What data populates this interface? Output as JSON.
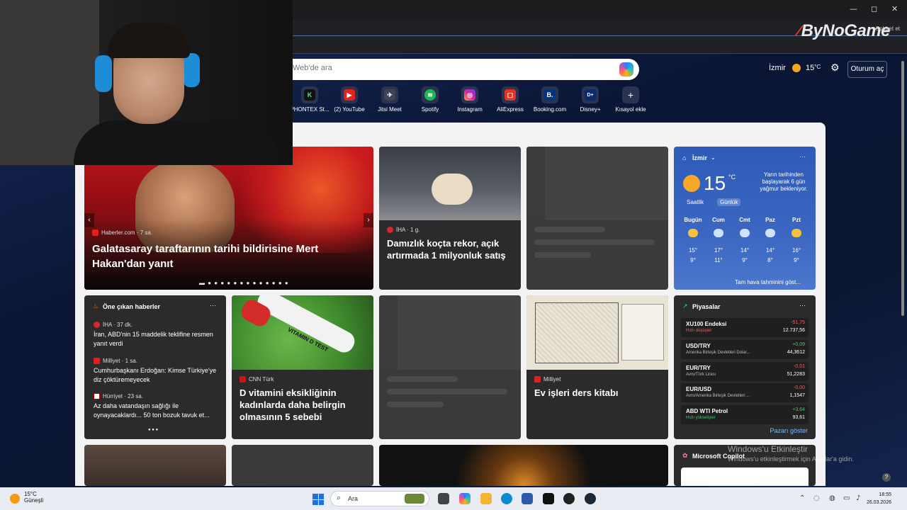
{
  "browser": {
    "brand_text": "ByNoGame",
    "sohbet_label": "Sohbet et",
    "minimize": "—",
    "maximize": "◻",
    "close": "✕"
  },
  "search": {
    "placeholder": "Web'de ara"
  },
  "header": {
    "city": "İzmir",
    "temp": "15",
    "temp_unit": "°C",
    "signin_label": "Oturum aç"
  },
  "shortcuts": [
    {
      "label": "PHONTEX St...",
      "icon": "phontex-icon",
      "glyph": "K",
      "color": "#1db954"
    },
    {
      "label": "(2) YouTube",
      "icon": "youtube-icon",
      "glyph": "▶",
      "color": "#e62117"
    },
    {
      "label": "Jitsi Meet",
      "icon": "jitsi-icon",
      "glyph": "✈",
      "color": "#3d4458"
    },
    {
      "label": "Spotify",
      "icon": "spotify-icon",
      "glyph": "≋",
      "color": "#1db954"
    },
    {
      "label": "Instagram",
      "icon": "instagram-icon",
      "glyph": "◎",
      "color": "#d6249f"
    },
    {
      "label": "AliExpress",
      "icon": "aliexpress-icon",
      "glyph": "▢",
      "color": "#e43225"
    },
    {
      "label": "Booking.com",
      "icon": "booking-icon",
      "glyph": "B.",
      "color": "#003580"
    },
    {
      "label": "Disney+",
      "icon": "disney-icon",
      "glyph": "D+",
      "color": "#0a2a6c"
    },
    {
      "label": "Kısayol ekle",
      "icon": "add-shortcut-icon",
      "glyph": "+",
      "color": "#3a3f50"
    }
  ],
  "hero": {
    "source": "Haberler.com",
    "age": "· 7 sa.",
    "headline": "Galatasaray taraftarının tarihi bildirisine Mert Hakan'dan yanıt",
    "dots": "▬ ● ● ● ● ● ● ● ● ● ● ● ● ●"
  },
  "sheep": {
    "source": "İHA",
    "age": "· 1 g.",
    "headline": "Damızlık koçta rekor, açık artırmada 1 milyonluk satış"
  },
  "weather": {
    "city": "İzmir",
    "temp": "15",
    "unit": "°C",
    "note": "Yarın tarihinden başlayarak 6 gün yağmur bekleniyor.",
    "tab_hourly": "Saatlik",
    "tab_daily": "Günlük",
    "days": [
      {
        "name": "Bugün",
        "hi": "15°",
        "lo": "9°",
        "icon": "partly-cloudy-icon"
      },
      {
        "name": "Cum",
        "hi": "17°",
        "lo": "11°",
        "icon": "rain-icon"
      },
      {
        "name": "Cmt",
        "hi": "14°",
        "lo": "9°",
        "icon": "rain-icon"
      },
      {
        "name": "Paz",
        "hi": "14°",
        "lo": "8°",
        "icon": "rain-icon"
      },
      {
        "name": "Pzt",
        "hi": "16°",
        "lo": "9°",
        "icon": "partly-cloudy-icon"
      }
    ],
    "more": "Tam hava tahminini göst..."
  },
  "top_stories": {
    "title": "Öne çıkan haberler",
    "items": [
      {
        "source": "İHA",
        "age": "· 37 dk.",
        "text": "İran, ABD'nin 15 maddelik teklifine resmen yanıt verdi"
      },
      {
        "source": "Milliyet",
        "age": "· 1 sa.",
        "text": "Cumhurbaşkanı Erdoğan: Kimse Türkiye'ye diz çöktüremeyecek"
      },
      {
        "source": "Hürriyet",
        "age": "· 23 sa.",
        "text": "Az daha vatandaşın sağlığı ile oynayacaklardı... 50 ton bozuk tavuk et..."
      }
    ],
    "dots": "● ● ●"
  },
  "vitamin": {
    "source": "CNN Türk",
    "headline": "D vitamini eksikliğinin kadınlarda daha belirgin olmasının 5 sebebi",
    "tube_text": "VITAMIN D TEST"
  },
  "book": {
    "source": "Milliyet",
    "headline": "Ev işleri ders kitabı"
  },
  "markets": {
    "title": "Piyasalar",
    "rows": [
      {
        "name": "XU100 Endeksi",
        "desc": "Hızlı düşüşler",
        "change": "-51,75",
        "value": "12.737,56",
        "dir": "down"
      },
      {
        "name": "USD/TRY",
        "desc": "Amerika Birleşik Devletleri Dolar...",
        "change": "+0,09",
        "value": "44,3612",
        "dir": "up"
      },
      {
        "name": "EUR/TRY",
        "desc": "Avro/Türk Lirası",
        "change": "-0,01",
        "value": "51,2283",
        "dir": "down"
      },
      {
        "name": "EUR/USD",
        "desc": "Avro/Amerika Birleşik Devletleri ...",
        "change": "-0,00",
        "value": "1,1547",
        "dir": "down"
      },
      {
        "name": "ABD WTI Petrol",
        "desc": "Hızlı yükselişler",
        "change": "+3,64",
        "value": "93,61",
        "dir": "up"
      }
    ],
    "more": "Pazarı göster",
    "up_color": "#3ecf6e",
    "down_color": "#ff5a5a"
  },
  "copilot": {
    "title": "Microsoft Copilot"
  },
  "watermark": {
    "line1": "Windows'u Etkinleştir",
    "line2": "Windows'u etkinleştirmek için Ayarlar'a gidin."
  },
  "taskbar": {
    "weather_temp": "15°C",
    "weather_desc": "Güneşli",
    "search_label": "Ara",
    "time": "18:55",
    "date": "26.03.2026"
  }
}
